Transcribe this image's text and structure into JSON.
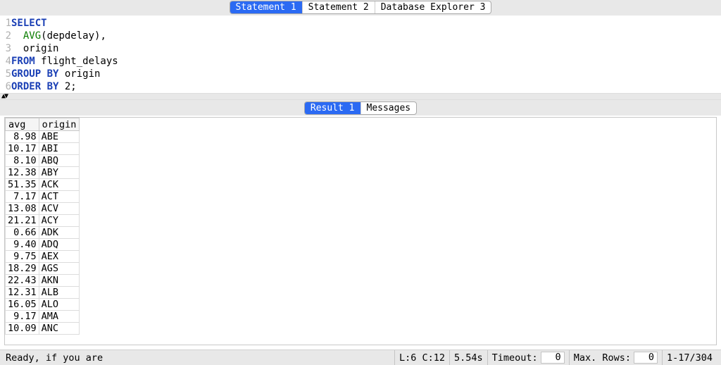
{
  "top_tabs": {
    "items": [
      "Statement 1",
      "Statement 2",
      "Database Explorer 3"
    ],
    "active_index": 0
  },
  "editor": {
    "lines": [
      [
        {
          "t": "SELECT",
          "c": "kw"
        }
      ],
      [
        {
          "t": "  ",
          "c": "plain"
        },
        {
          "t": "AVG",
          "c": "id"
        },
        {
          "t": "(depdelay),",
          "c": "plain"
        }
      ],
      [
        {
          "t": "  origin",
          "c": "plain"
        }
      ],
      [
        {
          "t": "FROM",
          "c": "kw"
        },
        {
          "t": " flight_delays",
          "c": "plain"
        }
      ],
      [
        {
          "t": "GROUP BY",
          "c": "kw"
        },
        {
          "t": " origin",
          "c": "plain"
        }
      ],
      [
        {
          "t": "ORDER BY",
          "c": "kw"
        },
        {
          "t": " 2;",
          "c": "plain"
        }
      ]
    ]
  },
  "result_tabs": {
    "items": [
      "Result 1",
      "Messages"
    ],
    "active_index": 0
  },
  "result": {
    "columns": [
      "avg",
      "origin"
    ],
    "rows": [
      {
        "avg": "8.98",
        "origin": "ABE"
      },
      {
        "avg": "10.17",
        "origin": "ABI"
      },
      {
        "avg": "8.10",
        "origin": "ABQ"
      },
      {
        "avg": "12.38",
        "origin": "ABY"
      },
      {
        "avg": "51.35",
        "origin": "ACK"
      },
      {
        "avg": "7.17",
        "origin": "ACT"
      },
      {
        "avg": "13.08",
        "origin": "ACV"
      },
      {
        "avg": "21.21",
        "origin": "ACY"
      },
      {
        "avg": "0.66",
        "origin": "ADK"
      },
      {
        "avg": "9.40",
        "origin": "ADQ"
      },
      {
        "avg": "9.75",
        "origin": "AEX"
      },
      {
        "avg": "18.29",
        "origin": "AGS"
      },
      {
        "avg": "22.43",
        "origin": "AKN"
      },
      {
        "avg": "12.31",
        "origin": "ALB"
      },
      {
        "avg": "16.05",
        "origin": "ALO"
      },
      {
        "avg": "9.17",
        "origin": "AMA"
      },
      {
        "avg": "10.09",
        "origin": "ANC"
      }
    ]
  },
  "status": {
    "message": "Ready, if you are",
    "cursor": "L:6 C:12",
    "exec_time": "5.54s",
    "timeout_label": "Timeout:",
    "timeout_value": "0",
    "maxrows_label": "Max. Rows:",
    "maxrows_value": "0",
    "row_range": "1-17/304"
  }
}
